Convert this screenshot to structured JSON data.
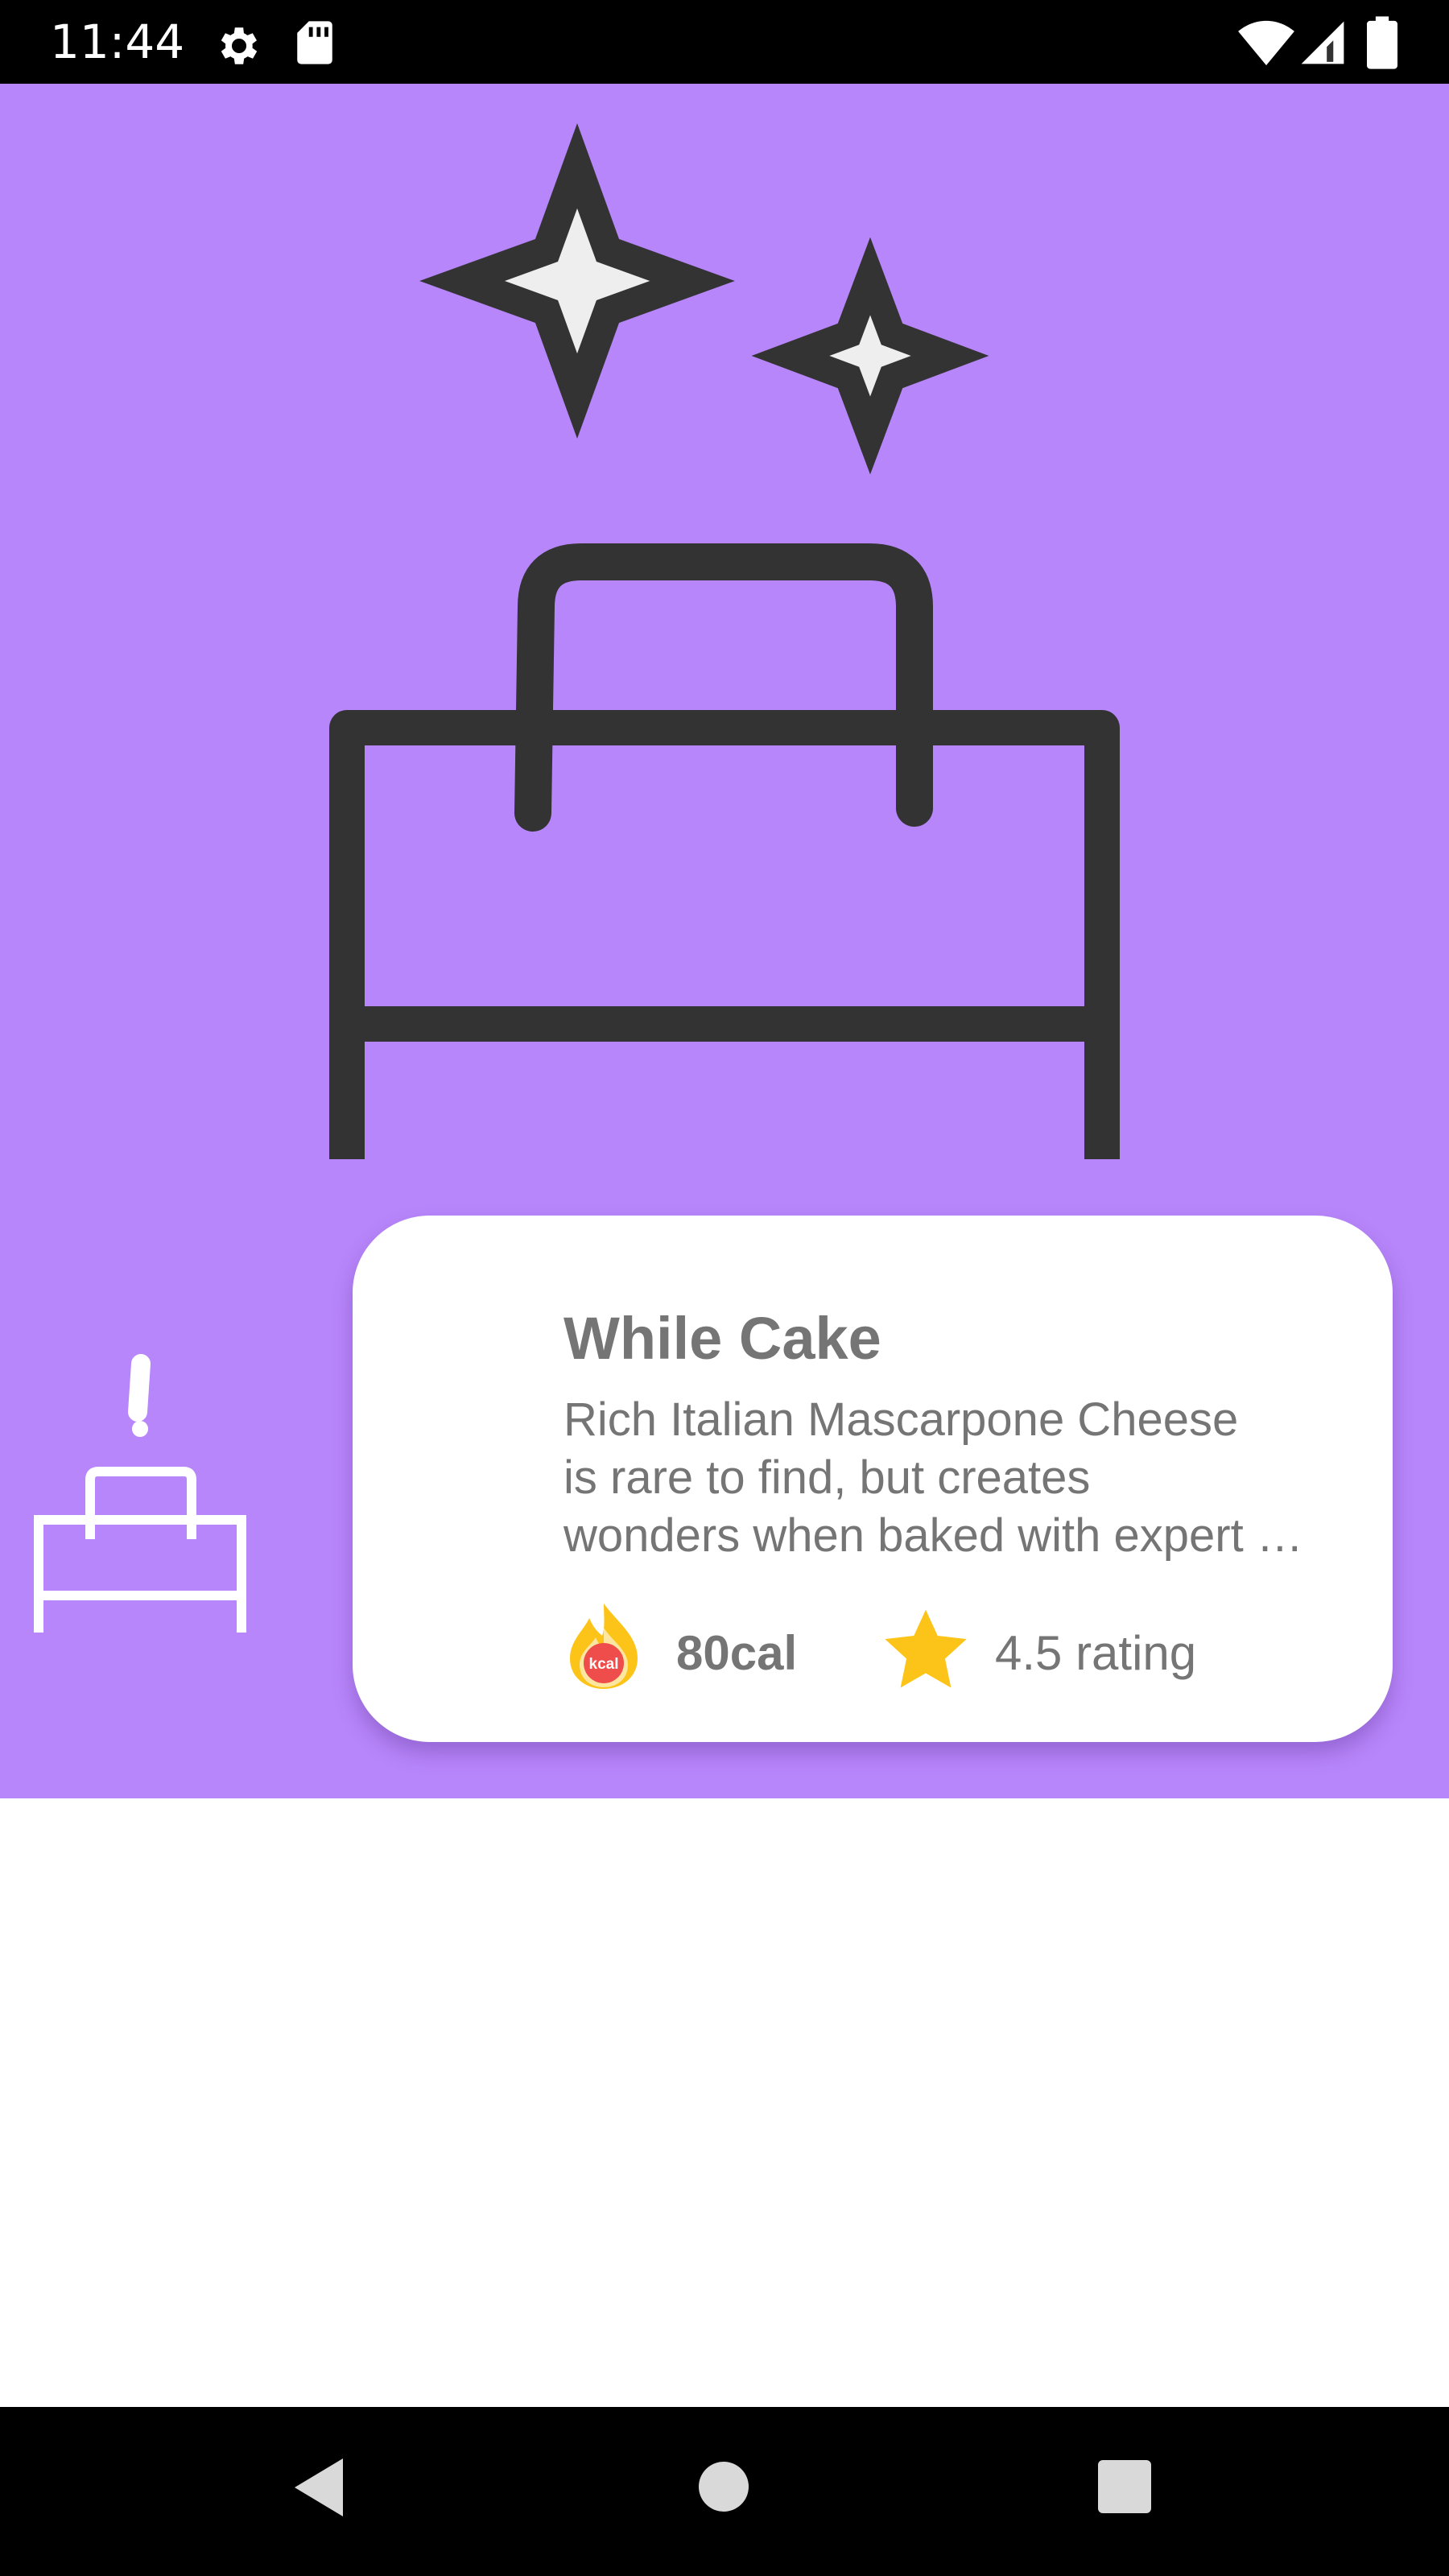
{
  "status_bar": {
    "time": "11:44",
    "icons": [
      "gear-icon",
      "sd-card-icon",
      "wifi-icon",
      "cellular-signal-icon",
      "battery-icon"
    ]
  },
  "hero": {
    "background_color": "#b886fb",
    "illustration": [
      "sparkle-icon",
      "cake-icon"
    ]
  },
  "item_card": {
    "title": "While Cake",
    "description_lines": [
      "Rich Italian Mascarpone Cheese",
      "is rare to find, but creates",
      "wonders when baked with expert …"
    ],
    "calories": {
      "icon": "kcal-flame-icon",
      "badge": "kcal",
      "value": "80cal"
    },
    "rating": {
      "icon": "star-icon",
      "value": "4.5 rating"
    }
  },
  "side_icon": "cake-alert-icon",
  "nav_bar": {
    "buttons": [
      "back-icon",
      "home-icon",
      "recents-icon"
    ]
  },
  "colors": {
    "accent": "#b886fb",
    "icon_dark": "#333333",
    "star": "#fcc419",
    "text_gray": "#757575"
  }
}
